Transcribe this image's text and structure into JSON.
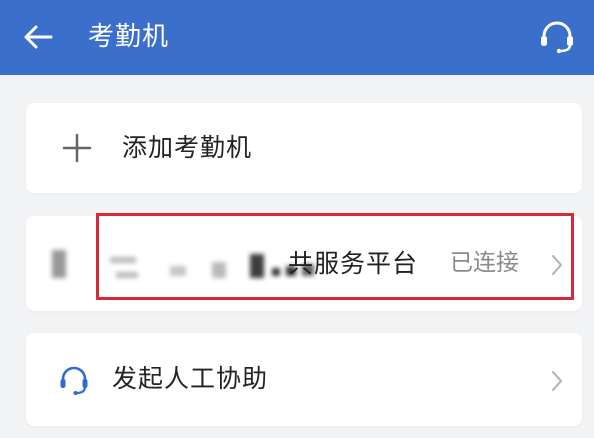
{
  "appbar": {
    "title": "考勤机",
    "background": "#3a6fcb",
    "back_icon": "arrow-left-icon",
    "service_icon": "headset-icon"
  },
  "add_device": {
    "label": "添加考勤机",
    "icon": "plus-icon"
  },
  "device": {
    "name_visible": "共服务平台",
    "name_obscured": true,
    "status": "已连接",
    "highlight_color": "#d62a3b"
  },
  "help": {
    "label": "发起人工协助",
    "icon": "headset-icon"
  }
}
